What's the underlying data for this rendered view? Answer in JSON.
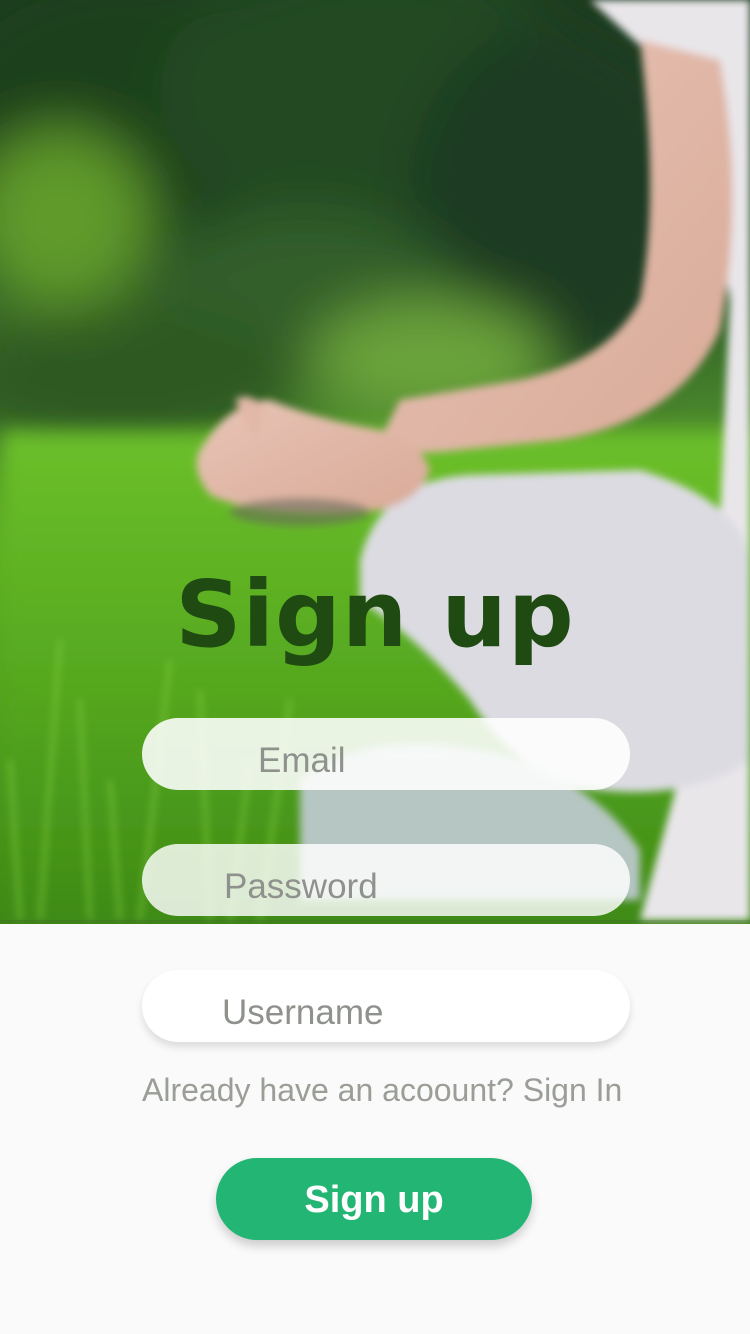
{
  "hero": {
    "description_icon": "yoga-meditation-photo"
  },
  "title": "Sign up",
  "form": {
    "email_placeholder": "Email",
    "password_placeholder": "Password",
    "username_placeholder": "Username",
    "signin_prompt": "Already have an acoount? Sign In",
    "submit_label": "Sign up"
  },
  "colors": {
    "title": "#1f4a12",
    "button": "#22b573",
    "prompt_text": "#9a9e97",
    "background": "#fafafa"
  }
}
